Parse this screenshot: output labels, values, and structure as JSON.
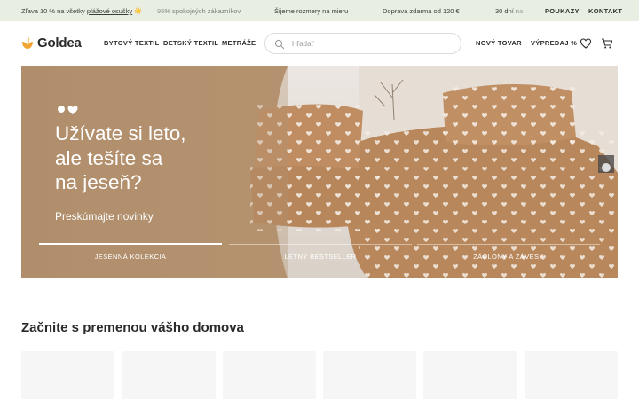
{
  "topbar": {
    "promo_prefix": "Zľava 10 % na všetky",
    "promo_link": "plážové osušky",
    "promo_emoji": "☀️",
    "satisfied": "95% spokojných zákazníkov",
    "made_to_measure": "Šijeme rozmery na mieru",
    "free_shipping": "Doprava zdarma od 120 €",
    "returns_partial": "30 dní na",
    "vouchers": "POUKAZY",
    "contact": "KONTAKT"
  },
  "header": {
    "logo": "Goldea",
    "nav": [
      "BYTOVÝ TEXTIL",
      "DETSKÝ TEXTIL",
      "METRÁŽE"
    ],
    "search_placeholder": "Hľadať",
    "new_goods": "NOVÝ TOVAR",
    "sale": "VÝPREDAJ %"
  },
  "hero": {
    "title_lines": [
      "Užívate si leto,",
      "ale tešíte sa",
      "na jeseň?"
    ],
    "subtitle": "Preskúmajte novinky",
    "tabs": [
      "JESENNÁ KOLEKCIA",
      "LETNÝ BESTSELLER",
      "ZÁCLONY A ZÁVESY"
    ]
  },
  "section": {
    "title_regular": "Začnite s premenou",
    "title_bold": "vášho domova"
  },
  "colors": {
    "topbar_bg": "#e8eee1",
    "logo_accent": "#f0a532",
    "hero_bedding": "#b8875c",
    "card_bg": "#f6f6f6"
  }
}
